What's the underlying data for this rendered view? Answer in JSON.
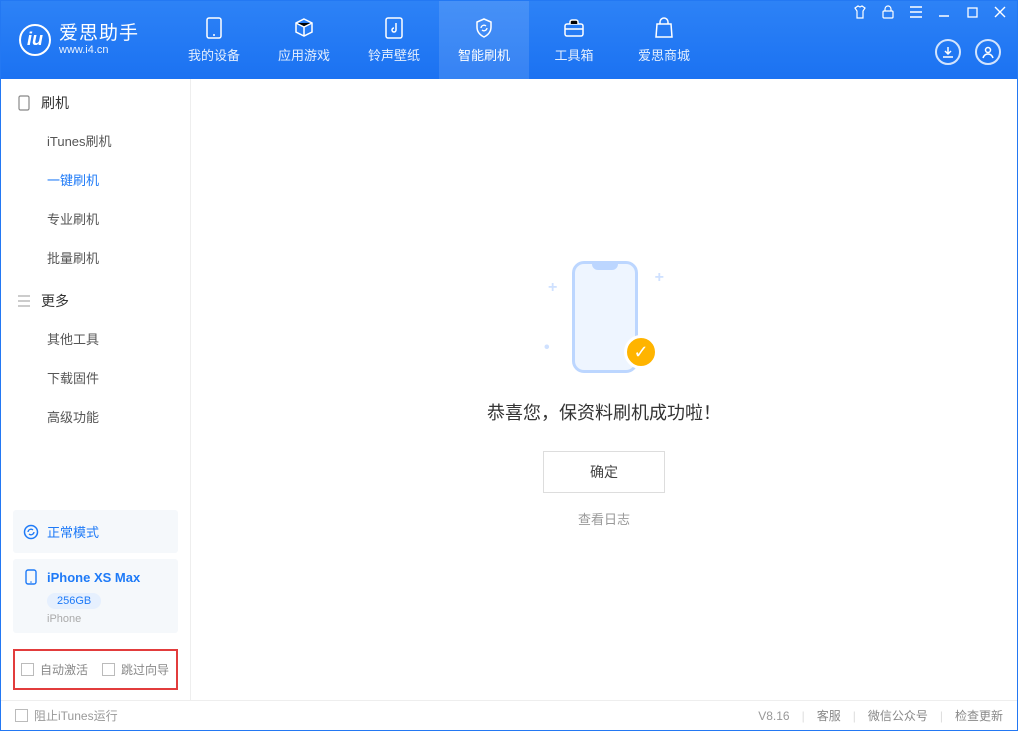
{
  "app": {
    "title": "爱思助手",
    "subtitle": "www.i4.cn"
  },
  "nav": {
    "items": [
      {
        "label": "我的设备"
      },
      {
        "label": "应用游戏"
      },
      {
        "label": "铃声壁纸"
      },
      {
        "label": "智能刷机"
      },
      {
        "label": "工具箱"
      },
      {
        "label": "爱思商城"
      }
    ]
  },
  "sidebar": {
    "group1": {
      "title": "刷机",
      "items": [
        {
          "label": "iTunes刷机"
        },
        {
          "label": "一键刷机"
        },
        {
          "label": "专业刷机"
        },
        {
          "label": "批量刷机"
        }
      ]
    },
    "group2": {
      "title": "更多",
      "items": [
        {
          "label": "其他工具"
        },
        {
          "label": "下载固件"
        },
        {
          "label": "高级功能"
        }
      ]
    },
    "mode": "正常模式",
    "device": {
      "name": "iPhone XS Max",
      "storage": "256GB",
      "type": "iPhone"
    },
    "options": {
      "auto_activate": "自动激活",
      "skip_guide": "跳过向导"
    }
  },
  "main": {
    "message": "恭喜您，保资料刷机成功啦！",
    "ok": "确定",
    "log_link": "查看日志"
  },
  "footer": {
    "block_itunes": "阻止iTunes运行",
    "version": "V8.16",
    "links": {
      "service": "客服",
      "wechat": "微信公众号",
      "update": "检查更新"
    }
  }
}
